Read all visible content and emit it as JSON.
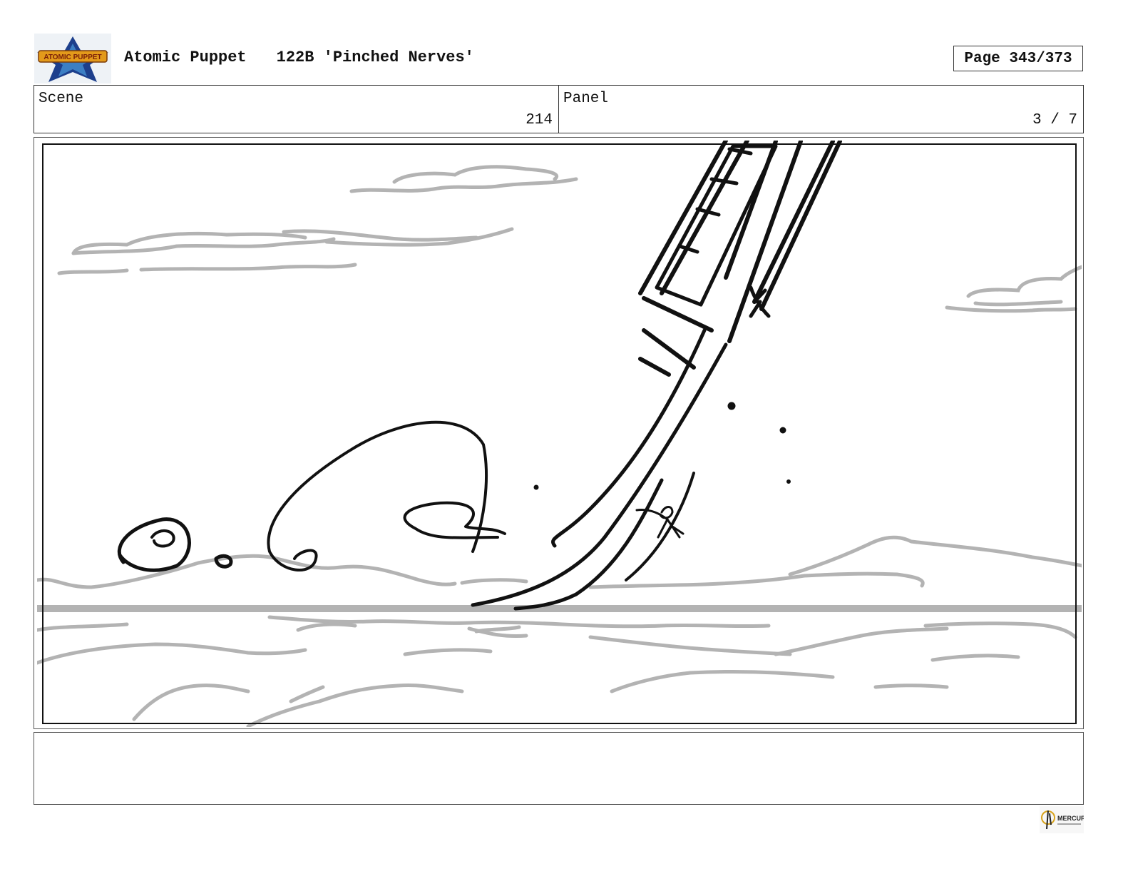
{
  "header": {
    "logo_text": "ATOMIC PUPPET",
    "show_title": "Atomic Puppet",
    "episode": "122B 'Pinched Nerves'",
    "page_label": "Page 343/373"
  },
  "info": {
    "scene_label": "Scene",
    "scene_value": "214",
    "panel_label": "Panel",
    "panel_value": "3 / 7"
  },
  "notes": {
    "text": ""
  },
  "footer": {
    "studio_logo_text": "MERCURY"
  },
  "colors": {
    "ink": "#111111",
    "cloud": "#b3b3b3",
    "logo_blue": "#1d3f8c",
    "logo_orange": "#e39a1b"
  }
}
